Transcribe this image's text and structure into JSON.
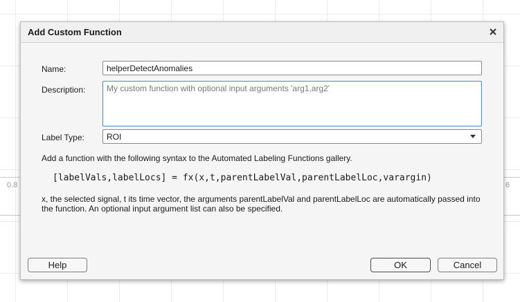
{
  "background": {
    "left_tick_label": "0.8",
    "right_tick_label": "6"
  },
  "dialog": {
    "title": "Add Custom Function",
    "close_icon": "close-icon",
    "name_label": "Name:",
    "name_value": "helperDetectAnomalies",
    "description_label": "Description:",
    "description_placeholder": "My custom function with optional input arguments 'arg1,arg2'",
    "description_value": "",
    "label_type_label": "Label Type:",
    "label_type_value": "ROI",
    "instruction": "Add a function with the following syntax to the Automated Labeling Functions gallery.",
    "syntax": "[labelVals,labelLocs] = fx(x,t,parentLabelVal,parentLabelLoc,varargin)",
    "note": "x, the selected signal, t its time vector, the arguments parentLabelVal and parentLabelLoc are automatically passed into the function. An optional input argument list can also be specified.",
    "buttons": {
      "help": "Help",
      "ok": "OK",
      "cancel": "Cancel"
    }
  },
  "colors": {
    "focus_border": "#3d8ee0",
    "dialog_bg": "#f5f5f5"
  }
}
